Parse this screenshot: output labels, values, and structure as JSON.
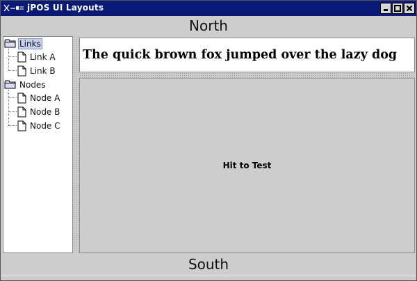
{
  "window": {
    "title": "jPOS UI Layouts",
    "icon": "jpos-logo-icon",
    "buttons": [
      "minimize-icon",
      "maximize-icon",
      "close-icon"
    ]
  },
  "north": {
    "label": "North"
  },
  "south": {
    "label": "South"
  },
  "tree": {
    "nodes": [
      {
        "label": "Links",
        "type": "folder",
        "selected": true,
        "children": [
          {
            "label": "Link A"
          },
          {
            "label": "Link B"
          }
        ]
      },
      {
        "label": "Nodes",
        "type": "folder",
        "selected": false,
        "children": [
          {
            "label": "Node A"
          },
          {
            "label": "Node B"
          },
          {
            "label": "Node C"
          }
        ]
      }
    ]
  },
  "text_panel": {
    "text": "The quick brown fox jumped over the lazy dog"
  },
  "test_panel": {
    "label": "Hit to Test"
  },
  "colors": {
    "titlebar": "#0a1a78",
    "background": "#cdcdcd",
    "selection": "#c9d0f0"
  }
}
